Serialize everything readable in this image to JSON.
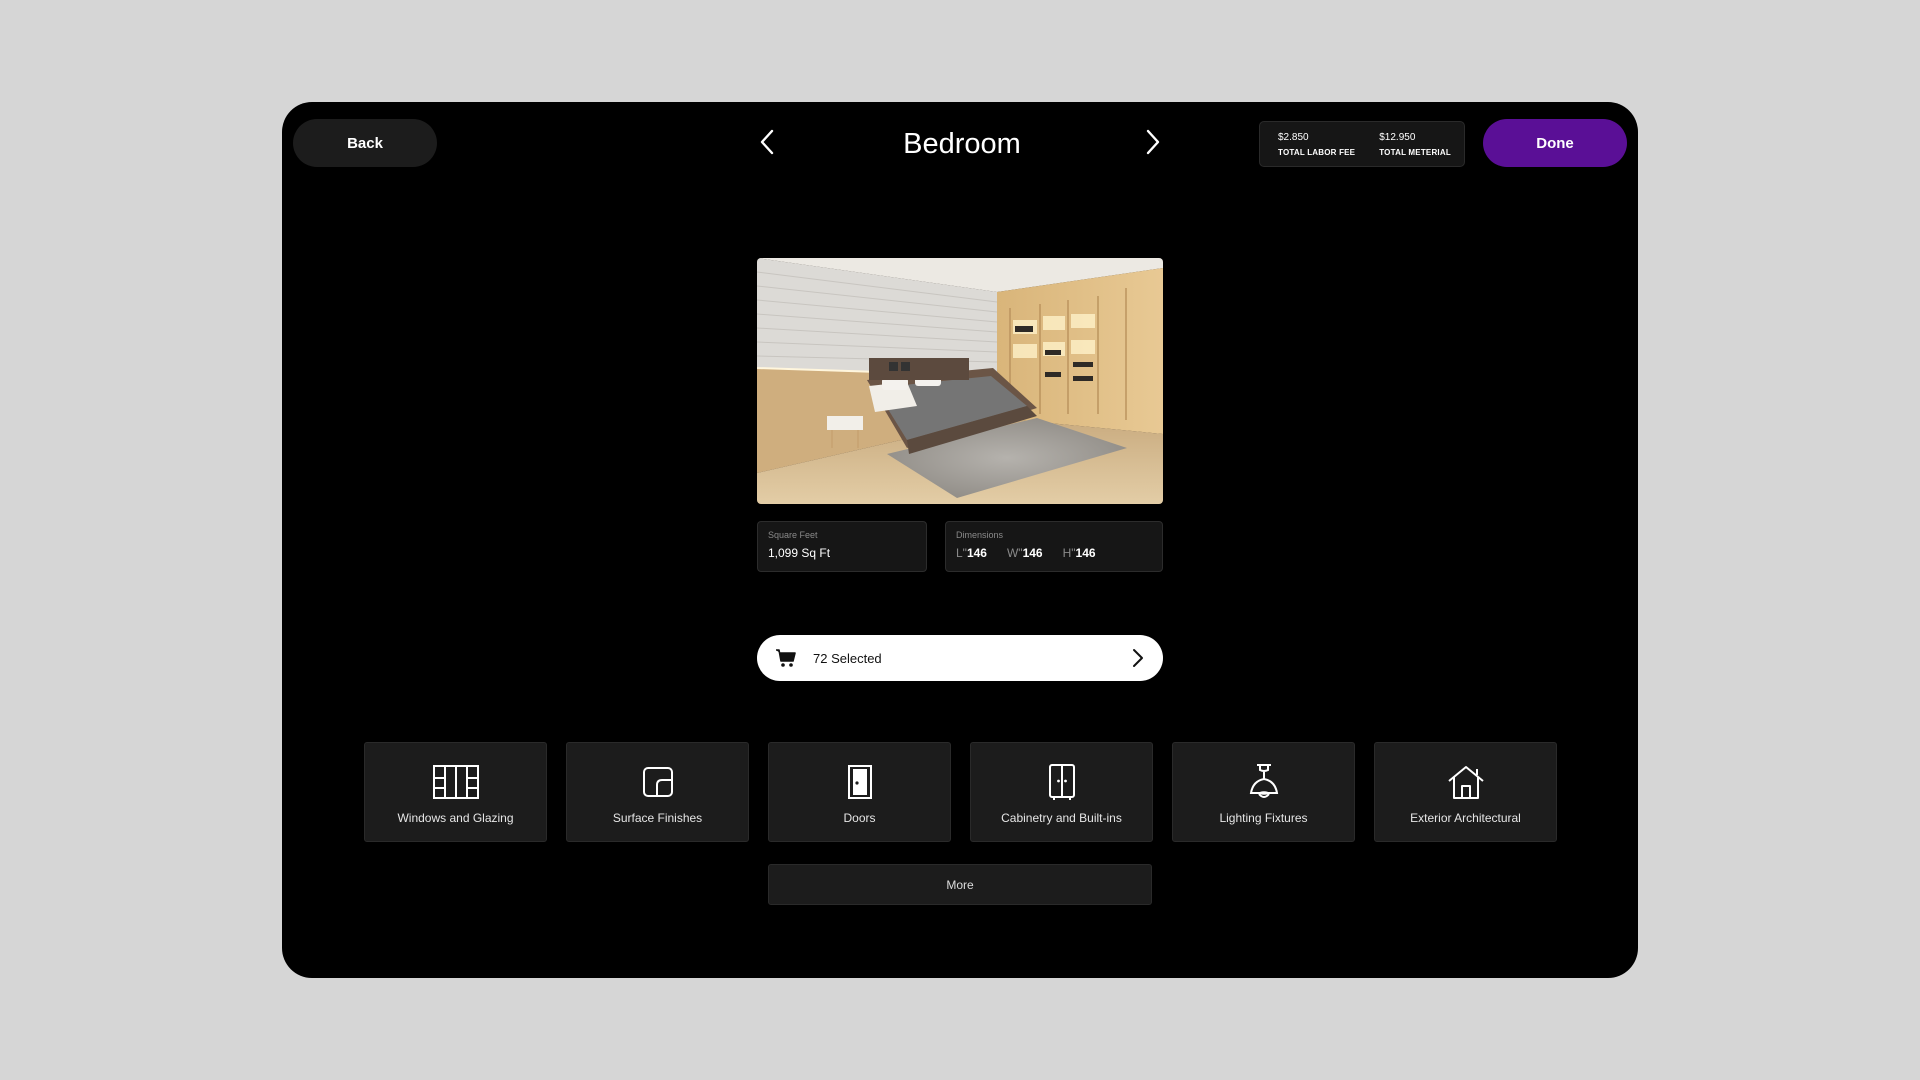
{
  "header": {
    "back_label": "Back",
    "title": "Bedroom",
    "done_label": "Done",
    "totals": [
      {
        "amount": "$2.850",
        "label": "TOTAL LABOR FEE"
      },
      {
        "amount": "$12.950",
        "label": "TOTAL METERIAL"
      }
    ]
  },
  "room": {
    "square_feet_label": "Square Feet",
    "square_feet_value": "1,099 Sq Ft",
    "dimensions_label": "Dimensions",
    "dimensions": [
      {
        "key": "L\"",
        "value": "146"
      },
      {
        "key": "W\"",
        "value": "146"
      },
      {
        "key": "H\"",
        "value": "146"
      }
    ]
  },
  "cart": {
    "label": "72 Selected",
    "icon": "cart-icon"
  },
  "categories": [
    {
      "label": "Windows and Glazing",
      "icon": "window-icon"
    },
    {
      "label": "Surface Finishes",
      "icon": "surface-icon"
    },
    {
      "label": "Doors",
      "icon": "door-icon"
    },
    {
      "label": "Cabinetry and Built-ins",
      "icon": "cabinet-icon"
    },
    {
      "label": "Lighting Fixtures",
      "icon": "lamp-icon"
    },
    {
      "label": "Exterior Architectural",
      "icon": "house-icon"
    }
  ],
  "more_label": "More",
  "colors": {
    "accent": "#5a0f96",
    "background": "#000000",
    "page": "#d6d6d6"
  }
}
